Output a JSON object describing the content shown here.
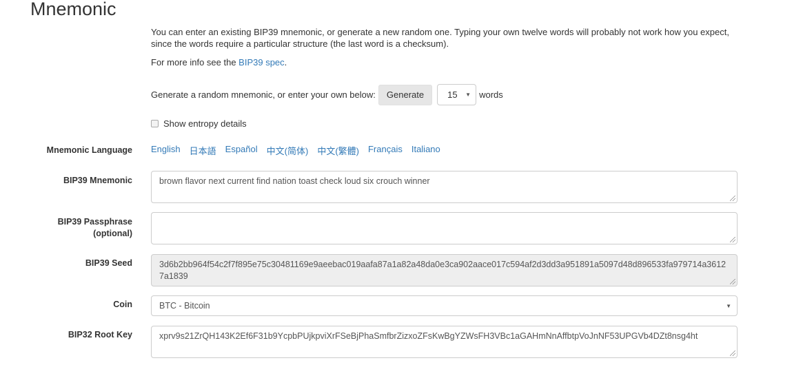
{
  "section": {
    "title": "Mnemonic",
    "intro_text": "You can enter an existing BIP39 mnemonic, or generate a new random one. Typing your own twelve words will probably not work how you expect, since the words require a particular structure (the last word is a checksum).",
    "more_info_prefix": "For more info see the ",
    "more_info_link": "BIP39 spec",
    "more_info_suffix": "."
  },
  "generate": {
    "prompt": "Generate a random mnemonic, or enter your own below:",
    "button_label": "Generate",
    "word_count_selected": "15",
    "words_label": "words"
  },
  "entropy": {
    "checkbox_label": "Show entropy details",
    "checked": false
  },
  "language": {
    "label": "Mnemonic Language",
    "options": [
      "English",
      "日本語",
      "Español",
      "中文(简体)",
      "中文(繁體)",
      "Français",
      "Italiano"
    ]
  },
  "fields": {
    "mnemonic": {
      "label": "BIP39 Mnemonic",
      "value": "brown flavor next current find nation toast check loud six crouch winner"
    },
    "passphrase": {
      "label_line1": "BIP39 Passphrase",
      "label_line2": "(optional)",
      "value": ""
    },
    "seed": {
      "label": "BIP39 Seed",
      "value": "3d6b2bb964f54c2f7f895e75c30481169e9aeebac019aafa87a1a82a48da0e3ca902aace017c594af2d3dd3a951891a5097d48d896533fa979714a36127a1839"
    },
    "coin": {
      "label": "Coin",
      "selected": "BTC - Bitcoin"
    },
    "root_key": {
      "label": "BIP32 Root Key",
      "value": "xprv9s21ZrQH143K2Ef6F31b9YcpbPUjkpviXrFSeBjPhaSmfbrZizxoZFsKwBgYZWsFH3VBc1aGAHmNnAffbtpVoJnNF53UPGVb4DZt8nsg4ht"
    }
  },
  "icons": {
    "dropdown_caret": "▼"
  },
  "colors": {
    "link": "#337ab7",
    "readonly_bg": "#eeeeee",
    "button_bg": "#e6e6e6"
  }
}
